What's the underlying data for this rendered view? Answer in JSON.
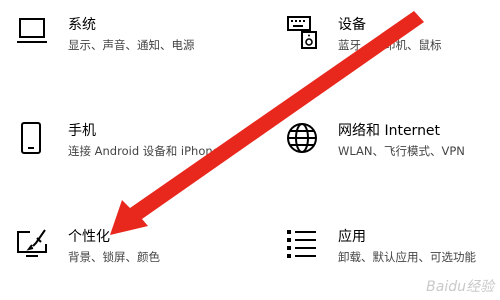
{
  "settings_tiles": [
    {
      "title": "系统",
      "description": "显示、声音、通知、电源",
      "icon": "laptop-icon"
    },
    {
      "title": "设备",
      "description": "蓝牙、打印机、鼠标",
      "icon": "keyboard-speaker-icon"
    },
    {
      "title": "手机",
      "description": "连接 Android 设备和 iPhone",
      "icon": "phone-icon"
    },
    {
      "title": "网络和 Internet",
      "description": "WLAN、飞行模式、VPN",
      "icon": "globe-icon"
    },
    {
      "title": "个性化",
      "description": "背景、锁屏、颜色",
      "icon": "paintbrush-monitor-icon"
    },
    {
      "title": "应用",
      "description": "卸载、默认应用、可选功能",
      "icon": "list-icon"
    }
  ],
  "watermark_text": "Baidu经验",
  "arrow_color": "#e8271d"
}
